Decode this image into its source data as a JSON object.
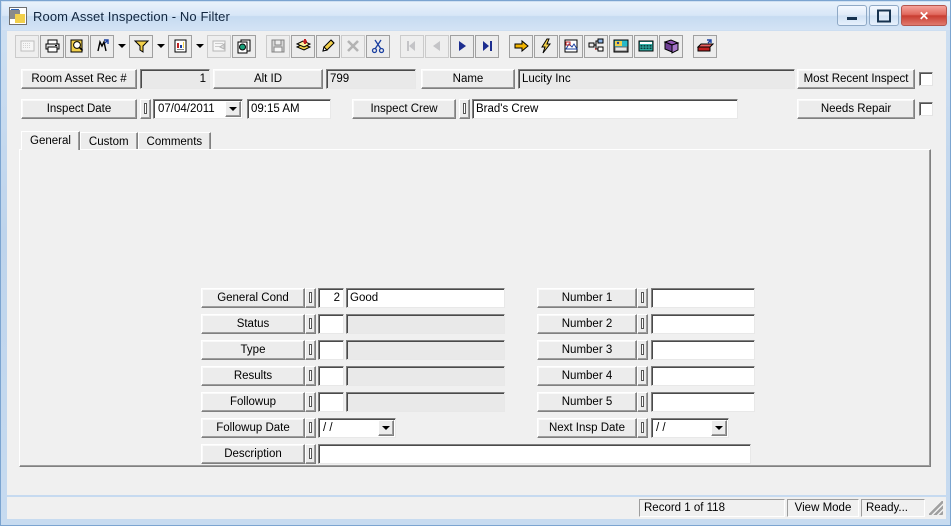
{
  "window": {
    "title": "Room Asset Inspection - No Filter",
    "app_icon": "room-asset-icon",
    "minimize_label": "",
    "maximize_label": "",
    "close_label": "✕"
  },
  "toolbar": {
    "buttons": [
      {
        "name": "select-grid-icon",
        "framed": true,
        "disabled": true,
        "dropdown": false
      },
      {
        "name": "print-icon",
        "framed": true,
        "disabled": false,
        "dropdown": false
      },
      {
        "name": "print-preview-icon",
        "framed": true,
        "disabled": false,
        "dropdown": false
      },
      {
        "name": "find-icon",
        "framed": true,
        "disabled": false,
        "dropdown": true
      },
      {
        "name": "filter-icon",
        "framed": true,
        "disabled": false,
        "dropdown": true
      },
      {
        "name": "report-icon",
        "framed": true,
        "disabled": false,
        "dropdown": true
      },
      {
        "name": "form-view-icon",
        "framed": true,
        "disabled": true,
        "dropdown": false
      },
      {
        "name": "copy-record-icon",
        "framed": true,
        "disabled": false,
        "dropdown": false
      },
      {
        "name": "separator",
        "framed": false,
        "disabled": false,
        "dropdown": false
      },
      {
        "name": "save-icon",
        "framed": true,
        "disabled": true,
        "dropdown": false
      },
      {
        "name": "add-record-icon",
        "framed": true,
        "disabled": false,
        "dropdown": false
      },
      {
        "name": "edit-record-icon",
        "framed": true,
        "disabled": false,
        "dropdown": false
      },
      {
        "name": "delete-record-icon",
        "framed": true,
        "disabled": true,
        "dropdown": false
      },
      {
        "name": "cut-icon",
        "framed": true,
        "disabled": false,
        "dropdown": false
      },
      {
        "name": "separator",
        "framed": false,
        "disabled": false,
        "dropdown": false
      },
      {
        "name": "first-record-icon",
        "framed": true,
        "disabled": true,
        "dropdown": false
      },
      {
        "name": "previous-record-icon",
        "framed": true,
        "disabled": true,
        "dropdown": false
      },
      {
        "name": "next-record-icon",
        "framed": true,
        "disabled": false,
        "dropdown": false
      },
      {
        "name": "last-record-icon",
        "framed": true,
        "disabled": false,
        "dropdown": false
      },
      {
        "name": "separator",
        "framed": false,
        "disabled": false,
        "dropdown": false
      },
      {
        "name": "goto-icon",
        "framed": true,
        "disabled": false,
        "dropdown": false
      },
      {
        "name": "quick-action-icon",
        "framed": true,
        "disabled": false,
        "dropdown": false
      },
      {
        "name": "map-icon",
        "framed": true,
        "disabled": false,
        "dropdown": false
      },
      {
        "name": "tree-view-icon",
        "framed": true,
        "disabled": false,
        "dropdown": false
      },
      {
        "name": "documents-icon",
        "framed": true,
        "disabled": false,
        "dropdown": false
      },
      {
        "name": "calculator-icon",
        "framed": true,
        "disabled": false,
        "dropdown": false
      },
      {
        "name": "help-book-icon",
        "framed": true,
        "disabled": false,
        "dropdown": false
      },
      {
        "name": "separator",
        "framed": false,
        "disabled": false,
        "dropdown": false
      },
      {
        "name": "exit-icon",
        "framed": true,
        "disabled": false,
        "dropdown": false
      }
    ]
  },
  "header": {
    "rec_label": "Room Asset Rec #",
    "rec_value": "1",
    "alt_id_label": "Alt ID",
    "alt_id_value": "799",
    "name_label": "Name",
    "name_value": "Lucity Inc",
    "most_recent_label": "Most Recent Inspect",
    "most_recent_checked": false,
    "inspect_date_label": "Inspect Date",
    "inspect_date_value": "07/04/2011",
    "inspect_time_value": "09:15 AM",
    "inspect_crew_label": "Inspect Crew",
    "inspect_crew_value": "Brad's Crew",
    "needs_repair_label": "Needs Repair",
    "needs_repair_checked": false
  },
  "tabs": [
    {
      "label": "General",
      "active": true
    },
    {
      "label": "Custom",
      "active": false
    },
    {
      "label": "Comments",
      "active": false
    }
  ],
  "general": {
    "left_fields": [
      {
        "label": "General Cond",
        "code": "2",
        "text": "Good",
        "readonly": false
      },
      {
        "label": "Status",
        "code": "",
        "text": "",
        "readonly": true
      },
      {
        "label": "Type",
        "code": "",
        "text": "",
        "readonly": true
      },
      {
        "label": "Results",
        "code": "",
        "text": "",
        "readonly": true
      },
      {
        "label": "Followup",
        "code": "",
        "text": "",
        "readonly": true
      }
    ],
    "followup_date_label": "Followup Date",
    "followup_date_value": "/  /",
    "description_label": "Description",
    "description_value": "",
    "right_fields": [
      {
        "label": "Number 1",
        "value": ""
      },
      {
        "label": "Number 2",
        "value": ""
      },
      {
        "label": "Number 3",
        "value": ""
      },
      {
        "label": "Number 4",
        "value": ""
      },
      {
        "label": "Number 5",
        "value": ""
      }
    ],
    "next_insp_date_label": "Next Insp Date",
    "next_insp_date_value": "/  /"
  },
  "statusbar": {
    "record": "Record 1 of 118",
    "mode": "View Mode",
    "state": "Ready..."
  }
}
